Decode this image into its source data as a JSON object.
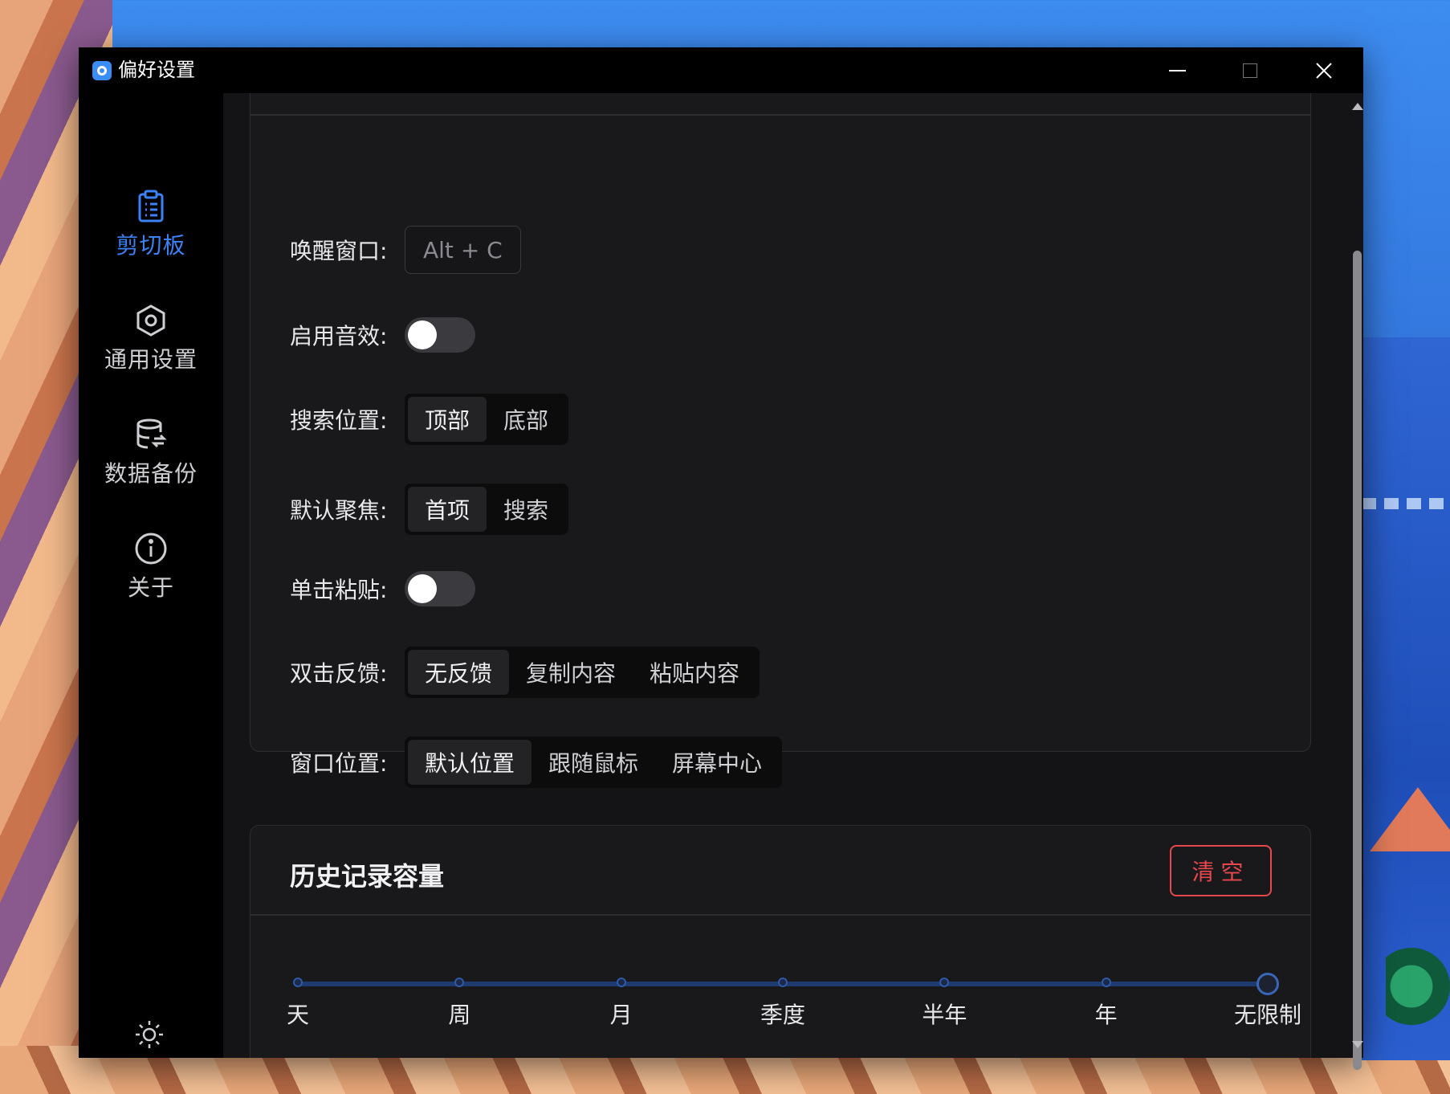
{
  "window": {
    "title": "偏好设置"
  },
  "sidebar": {
    "items": [
      {
        "label": "剪切板",
        "icon": "clipboard-icon",
        "active": true
      },
      {
        "label": "通用设置",
        "icon": "hexagon-settings-icon"
      },
      {
        "label": "数据备份",
        "icon": "database-backup-icon"
      },
      {
        "label": "关于",
        "icon": "info-icon"
      }
    ],
    "theme_icon": "sun-icon"
  },
  "settings": {
    "wake_window": {
      "label": "唤醒窗口:",
      "shortcut": "Alt + C"
    },
    "sound": {
      "label": "启用音效:",
      "enabled": false
    },
    "search_position": {
      "label": "搜索位置:",
      "options": [
        "顶部",
        "底部"
      ],
      "selected": "顶部"
    },
    "default_focus": {
      "label": "默认聚焦:",
      "options": [
        "首项",
        "搜索"
      ],
      "selected": "首项"
    },
    "single_click_paste": {
      "label": "单击粘贴:",
      "enabled": false
    },
    "double_click": {
      "label": "双击反馈:",
      "options": [
        "无反馈",
        "复制内容",
        "粘贴内容"
      ],
      "selected": "无反馈"
    },
    "window_position": {
      "label": "窗口位置:",
      "options": [
        "默认位置",
        "跟随鼠标",
        "屏幕中心"
      ],
      "selected": "默认位置"
    }
  },
  "history": {
    "title": "历史记录容量",
    "clear_label": "清空",
    "marks": [
      "天",
      "周",
      "月",
      "季度",
      "半年",
      "年",
      "无限制"
    ],
    "selected": "无限制"
  },
  "colors": {
    "accent": "#3b82f6",
    "danger": "#e5484d",
    "background": "#141416"
  }
}
